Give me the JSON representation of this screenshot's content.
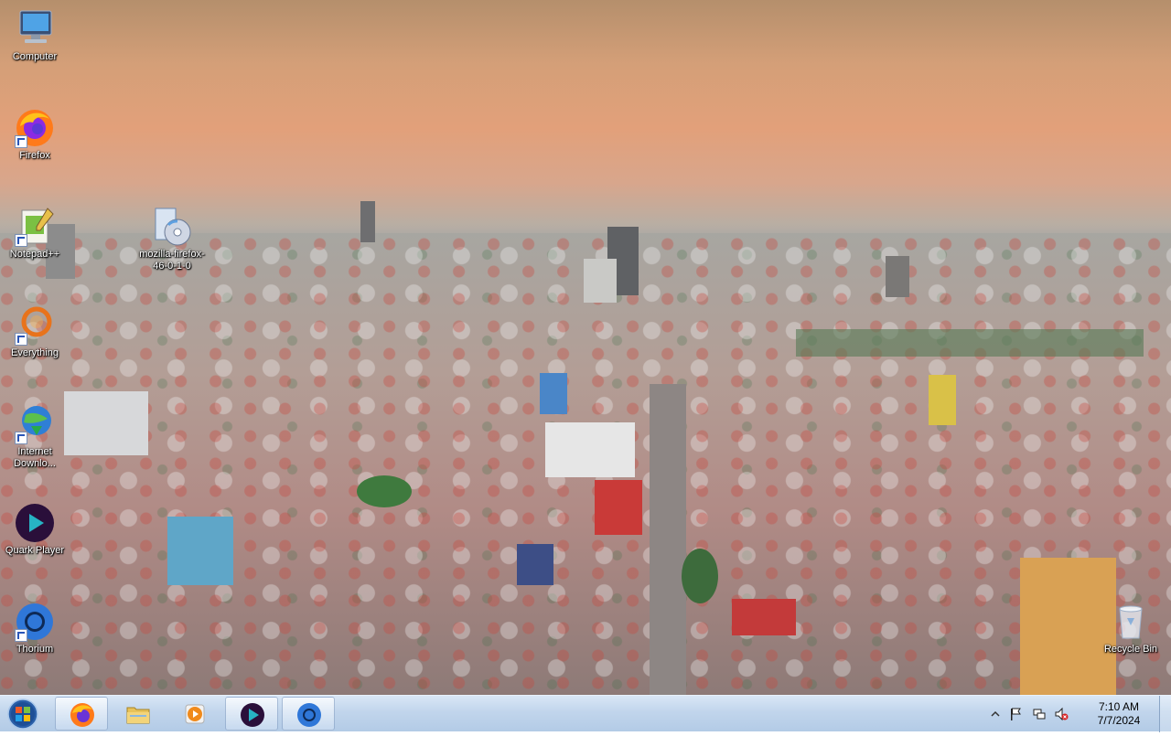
{
  "desktop_icons": [
    {
      "label": "Computer",
      "icon": "computer-icon"
    },
    {
      "label": "Firefox",
      "icon": "firefox-icon"
    },
    {
      "label": "Notepad++",
      "icon": "notepadpp-icon"
    },
    {
      "label": "mozilla-firefox-46-0-1-0",
      "icon": "installer-disc-icon"
    },
    {
      "label": "Everything",
      "icon": "everything-icon"
    },
    {
      "label": "Internet Downlo...",
      "icon": "internet-download-manager-icon"
    },
    {
      "label": "Quark Player",
      "icon": "quark-player-icon"
    },
    {
      "label": "Thorium",
      "icon": "thorium-icon"
    },
    {
      "label": "Recycle Bin",
      "icon": "recycle-bin-icon"
    }
  ],
  "taskbar": {
    "start_button": "start-orb-icon",
    "items": [
      {
        "name": "Firefox",
        "icon": "firefox-icon"
      },
      {
        "name": "Windows Explorer",
        "icon": "folder-icon"
      },
      {
        "name": "Windows Media Player",
        "icon": "media-player-icon"
      },
      {
        "name": "Quark Player",
        "icon": "quark-player-icon"
      },
      {
        "name": "Thorium",
        "icon": "thorium-icon"
      }
    ],
    "tray": {
      "icons": [
        "show-hidden-icons-arrow",
        "action-center-flag-icon",
        "network-icon",
        "volume-muted-icon"
      ],
      "time": "7:10 AM",
      "date": "7/7/2024"
    }
  },
  "colors": {
    "taskbar": "#c1d5ec",
    "sky_top": "#b58f6c",
    "roof_red": "#c8463c"
  }
}
